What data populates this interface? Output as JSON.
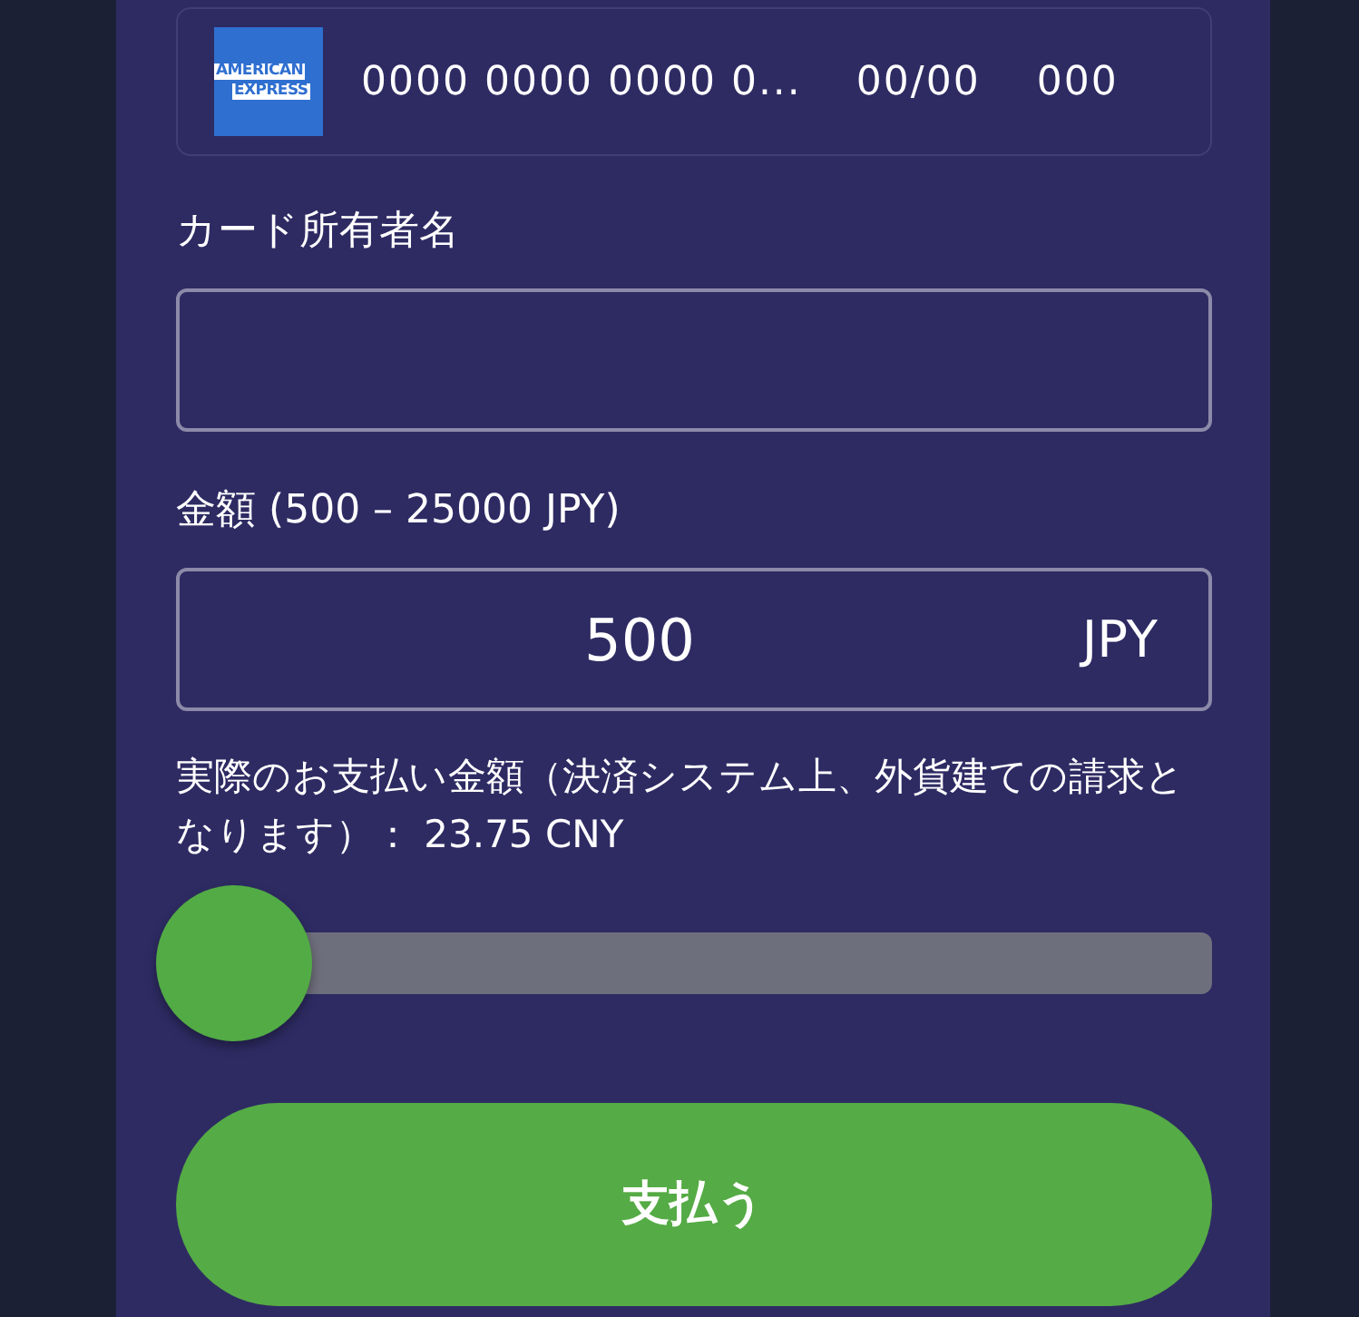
{
  "card_field": {
    "logo_lines": [
      "AMERICAN",
      "EXPRESS"
    ],
    "number": "0000 0000 0000 0...",
    "expiry": "00/00",
    "cvc": "000"
  },
  "holder": {
    "label": "カード所有者名"
  },
  "amount": {
    "label": "金額 (500 – 25000 JPY)",
    "value": "500",
    "currency": "JPY"
  },
  "note": "実際のお支払い金額（決済システム上、外貨建ての請求となります）： 23.75 CNY",
  "slider": {
    "level": 0
  },
  "pay_button": "支払う"
}
